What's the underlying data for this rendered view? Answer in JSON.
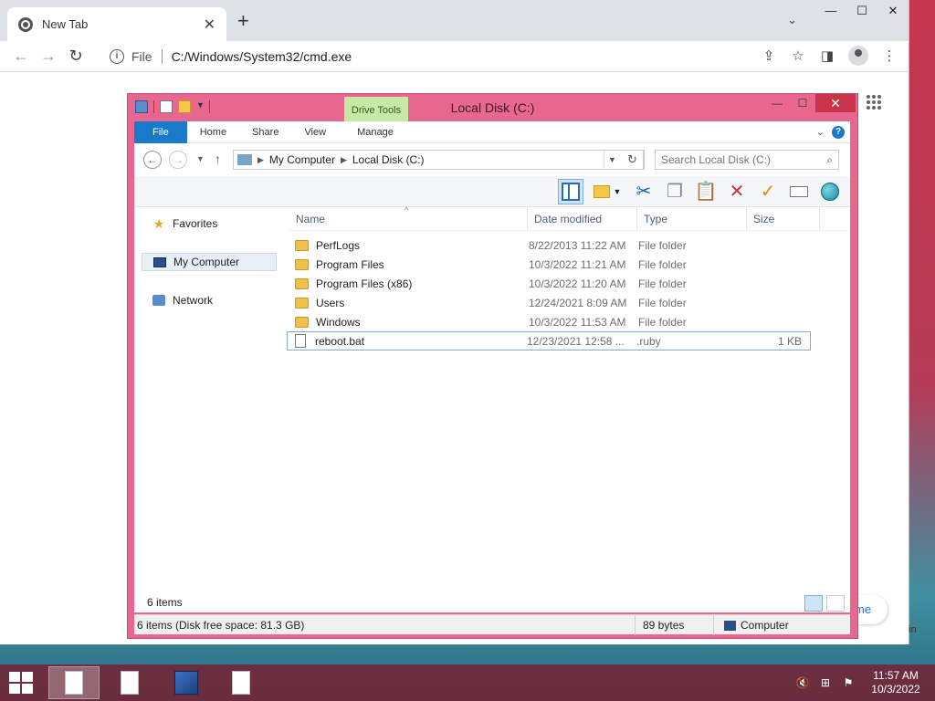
{
  "browser": {
    "tab_title": "New Tab",
    "tab_close": "✕",
    "new_tab": "+",
    "tab_search": "⌄",
    "win_min": "—",
    "win_max": "☐",
    "win_close": "✕",
    "nav_back": "←",
    "nav_forward": "→",
    "nav_reload": "↻",
    "info": "i",
    "scheme": "File",
    "url": "C:/Windows/System32/cmd.exe",
    "share": "⇪",
    "bookmark": "☆",
    "sidepanel": "◨",
    "menu": "⋮",
    "peek_text": "me",
    "peek_text2": "in"
  },
  "explorer": {
    "title": "Local Disk (C:)",
    "drive_tools": "Drive Tools",
    "ctrl_min": "—",
    "ctrl_max": "☐",
    "ctrl_close": "✕",
    "ribbon_tabs": [
      "File",
      "Home",
      "Share",
      "View",
      "Manage"
    ],
    "ribbon_chevron": "⌄",
    "help": "?",
    "nav_back": "←",
    "nav_forward": "→",
    "nav_more": "▼",
    "nav_up": "↑",
    "breadcrumb": [
      "My Computer",
      "Local Disk (C:)"
    ],
    "crumb_sep": "▶",
    "address_dropdown": "▼",
    "refresh": "↻",
    "search_placeholder": "Search Local Disk (C:)",
    "search_icon": "⌕",
    "cmd_icons": {
      "cut": "✂",
      "copy": "❐",
      "paste": "📋",
      "delete": "✕",
      "ok": "✓"
    },
    "nav_pane": {
      "favorites": "Favorites",
      "my_computer": "My Computer",
      "network": "Network",
      "star": "★"
    },
    "columns": [
      "Name",
      "Date modified",
      "Type",
      "Size"
    ],
    "sort_arrow": "^",
    "files": [
      {
        "name": "PerfLogs",
        "date": "8/22/2013 11:22 AM",
        "type": "File folder",
        "size": "",
        "kind": "folder"
      },
      {
        "name": "Program Files",
        "date": "10/3/2022 11:21 AM",
        "type": "File folder",
        "size": "",
        "kind": "folder"
      },
      {
        "name": "Program Files (x86)",
        "date": "10/3/2022 11:20 AM",
        "type": "File folder",
        "size": "",
        "kind": "folder"
      },
      {
        "name": "Users",
        "date": "12/24/2021 8:09 AM",
        "type": "File folder",
        "size": "",
        "kind": "folder"
      },
      {
        "name": "Windows",
        "date": "10/3/2022 11:53 AM",
        "type": "File folder",
        "size": "",
        "kind": "folder"
      },
      {
        "name": "reboot.bat",
        "date": "12/23/2021 12:58 ...",
        "type": ".ruby",
        "size": "1 KB",
        "kind": "file"
      }
    ],
    "item_count": "6 items",
    "status_summary": "6 items (Disk free space: 81.3 GB)",
    "status_size": "89 bytes",
    "status_location": "Computer"
  },
  "taskbar": {
    "clock_time": "11:57 AM",
    "clock_date": "10/3/2022",
    "tray": {
      "volume": "🔇",
      "network": "⊞",
      "flag": "⚑"
    }
  },
  "colors": {
    "explorer_frame": "#e8678f",
    "close_button": "#c9344a",
    "drive_tools_tab": "#c8e8a6",
    "file_tab": "#1979ca"
  }
}
